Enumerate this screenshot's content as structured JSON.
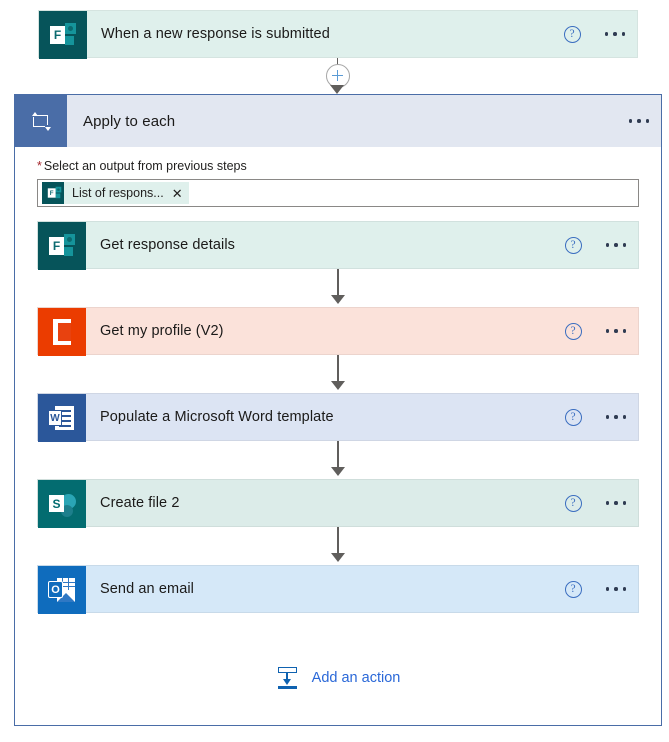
{
  "trigger": {
    "title": "When a new response is submitted",
    "icon": "microsoft-forms-icon",
    "icon_letter": "F",
    "background": "#dff0ec",
    "icon_background": "#06545a",
    "help_label": "?"
  },
  "connector": {
    "add_step_icon": "plus-circle-icon"
  },
  "scope": {
    "title": "Apply to each",
    "icon": "loop-icon",
    "header_background": "#e2e7f1",
    "icon_background": "#4a6da7",
    "border_color": "#4a6da7",
    "field": {
      "required_marker": "*",
      "label": "Select an output from previous steps",
      "token": {
        "text": "List of respons...",
        "icon": "microsoft-forms-icon",
        "icon_letter": "F",
        "remove_label": "✕"
      }
    },
    "actions": [
      {
        "title": "Get response details",
        "icon": "microsoft-forms-icon",
        "icon_letter": "F",
        "icon_kind": "forms",
        "background": "#dff0ec",
        "icon_background": "#06545a"
      },
      {
        "title": "Get my profile (V2)",
        "icon": "office-365-users-icon",
        "icon_letter": "",
        "icon_kind": "office",
        "background": "#fbe2da",
        "icon_background": "#eb3c00"
      },
      {
        "title": "Populate a Microsoft Word template",
        "icon": "microsoft-word-icon",
        "icon_letter": "W",
        "icon_kind": "word",
        "background": "#dce4f3",
        "icon_background": "#2b579a"
      },
      {
        "title": "Create file 2",
        "icon": "sharepoint-icon",
        "icon_letter": "S",
        "icon_kind": "sharepoint",
        "background": "#dcece9",
        "icon_background": "#036c70"
      },
      {
        "title": "Send an email",
        "icon": "outlook-icon",
        "icon_letter": "O",
        "icon_kind": "outlook",
        "background": "#d5e8f8",
        "icon_background": "#0f6cbd"
      }
    ],
    "add_action": {
      "label": "Add an action",
      "icon": "insert-action-icon",
      "color": "#2a68d8"
    },
    "help_label": "?"
  }
}
